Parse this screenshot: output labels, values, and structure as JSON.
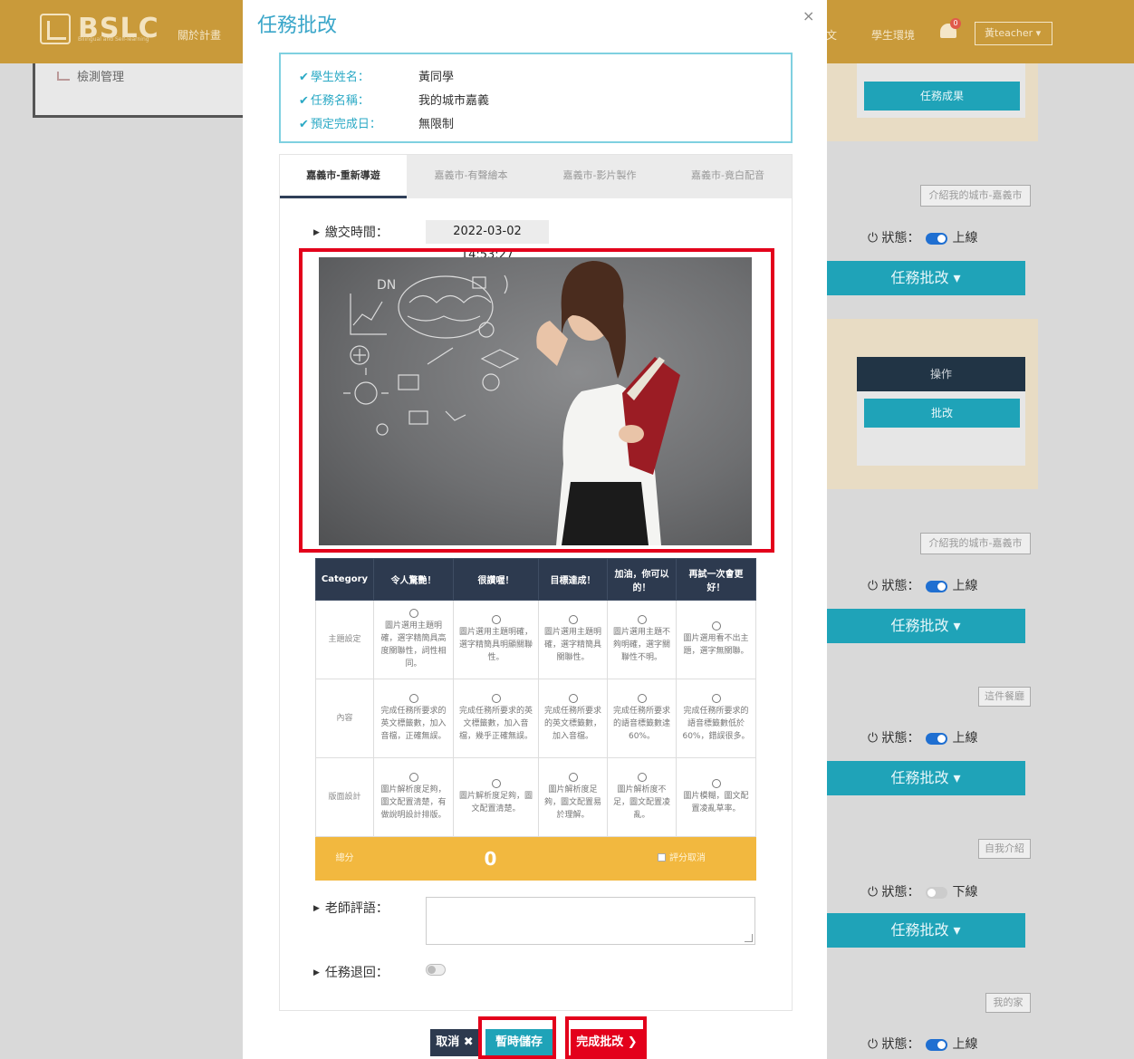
{
  "background": {
    "logo_text": "BSLC",
    "logo_subtitle": "Bilingual and Self-learning",
    "header_links": [
      "關於計畫",
      "文",
      "學生環境"
    ],
    "notification_count": "0",
    "user_label": "黃teacher ▾",
    "left_menu_item": "檢測管理",
    "buttons": {
      "task_result": "任務成果",
      "task_review": "任務批改 ▾",
      "review": "批改"
    },
    "table_header_op": "操作",
    "tags": [
      "介紹我的城市-嘉義市",
      "介紹我的城市-嘉義市",
      "這件餐廳",
      "自我介紹",
      "我的家"
    ],
    "status_label": "狀態：",
    "status_values": [
      "上線",
      "上線",
      "上線",
      "下線",
      "上線"
    ]
  },
  "modal": {
    "title": "任務批改",
    "close": "×",
    "info": [
      {
        "label": "學生姓名：",
        "value": "黃同學"
      },
      {
        "label": "任務名稱：",
        "value": "我的城市嘉義"
      },
      {
        "label": "預定完成日：",
        "value": "無限制"
      }
    ],
    "tabs": [
      "嘉義市-重新導遊",
      "嘉義市-有聲繪本",
      "嘉義市-影片製作",
      "嘉義市-竟白配音"
    ],
    "submit_time_label": "繳交時間：",
    "submit_time": "2022-03-02 14:53:27",
    "rubric": {
      "headers": [
        "Category",
        "令人驚艷！",
        "很讚喔！",
        "目標達成！",
        "加油，你可以的！",
        "再試一次會更好！"
      ],
      "rows": [
        {
          "category": "主題設定",
          "cells": [
            "圖片選用主題明確，選字精簡具高度關聯性，詞性相同。",
            "圖片選用主題明確，選字精簡具明顯關聯性。",
            "圖片選用主題明確，選字精簡具關聯性。",
            "圖片選用主題不夠明確，選字關聯性不明。",
            "圖片選用看不出主題，選字無關聯。"
          ]
        },
        {
          "category": "內容",
          "cells": [
            "完成任務所要求的英文標籤數，加入音檔，正確無誤。",
            "完成任務所要求的英文標籤數，加入音檔，幾乎正確無誤。",
            "完成任務所要求的英文標籤數，加入音檔。",
            "完成任務所要求的語音標籤數達60%。",
            "完成任務所要求的語音標籤數低於60%，錯誤很多。"
          ]
        },
        {
          "category": "版面設計",
          "cells": [
            "圖片解析度足夠，圖文配置清楚，有做說明設計排版。",
            "圖片解析度足夠，圖文配置清楚。",
            "圖片解析度足夠，圖文配置易於理解。",
            "圖片解析度不足，圖文配置凌亂。",
            "圖片模糊，圖文配置凌亂草率。"
          ]
        }
      ],
      "score_label": "總分",
      "score": "0",
      "cancel_label": "評分取消"
    },
    "comment_label": "老師評語：",
    "return_label": "任務退回：",
    "buttons": {
      "cancel": "取消 ✖",
      "save": "暫時儲存",
      "done": "完成批改 ❯"
    }
  }
}
